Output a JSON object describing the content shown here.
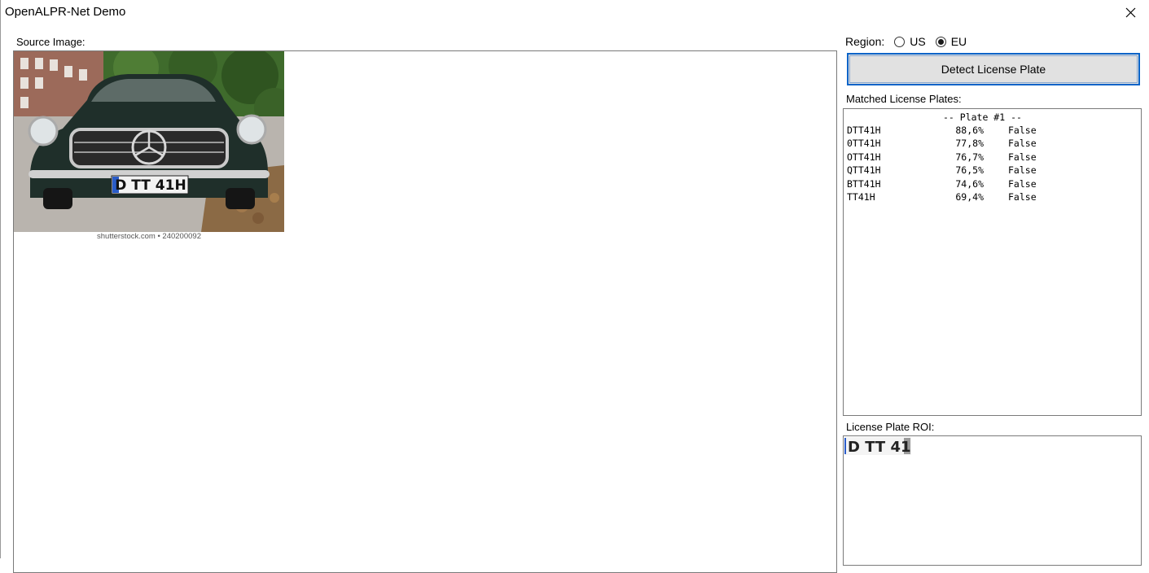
{
  "window": {
    "title": "OpenALPR-Net Demo",
    "close_icon": "close-icon"
  },
  "source": {
    "label": "Source Image:",
    "watermark": "shutterstock.com • 240200092",
    "plate_text": "D TT 41H"
  },
  "region": {
    "label": "Region:",
    "options": [
      {
        "label": "US",
        "checked": false
      },
      {
        "label": "EU",
        "checked": true
      }
    ]
  },
  "detect_button": {
    "label": "Detect License Plate"
  },
  "matched": {
    "label": "Matched License Plates:",
    "header": "-- Plate #1 --",
    "rows": [
      {
        "plate": "DTT41H",
        "confidence": "88,6%",
        "match": "False"
      },
      {
        "plate": "0TT41H",
        "confidence": "77,8%",
        "match": "False"
      },
      {
        "plate": "OTT41H",
        "confidence": "76,7%",
        "match": "False"
      },
      {
        "plate": "QTT41H",
        "confidence": "76,5%",
        "match": "False"
      },
      {
        "plate": "BTT41H",
        "confidence": "74,6%",
        "match": "False"
      },
      {
        "plate": "TT41H",
        "confidence": "69,4%",
        "match": "False"
      }
    ]
  },
  "roi": {
    "label": "License Plate ROI:",
    "plate_text": "D TT 41H"
  },
  "colors": {
    "accent": "#0a64c8",
    "button_bg": "#e1e1e1",
    "border": "#7a7a7a"
  }
}
